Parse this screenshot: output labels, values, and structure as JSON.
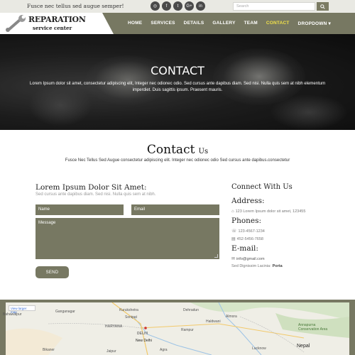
{
  "topbar": {
    "tagline": "Fusce nec tellus sed augue semper!",
    "social_icons": [
      "rss-icon",
      "facebook-icon",
      "twitter-icon",
      "google-plus-icon",
      "linkedin-icon"
    ],
    "social_glyphs": [
      "◎",
      "f",
      "t",
      "G+",
      "in"
    ],
    "search_placeholder": "Search"
  },
  "logo": {
    "line1": "REPARATION",
    "line2": "service center"
  },
  "nav": {
    "items": [
      "HOME",
      "SERVICES",
      "DETAILS",
      "GALLERY",
      "TEAM",
      "CONTACT",
      "DROPDOWN ▾"
    ],
    "active": "CONTACT"
  },
  "hero": {
    "title": "CONTACT",
    "text": "Lorem Ipsum dolor sit amet, consectetur adipiscing elit, Integer nec odionec odio. Sed cursus ante dapibus diam. Sed nisi. Nulla quis sem at nibh elementum imperdiet. Duis sagittis ipsum. Praesent mauris."
  },
  "contact_heading": {
    "title_big": "Contact",
    "title_small": "Us",
    "subtitle": "Fusce Nec Tellus Sed Augue consectetur adipiscing elit. Integer nec odionec odio Sed cursus ante dapibus.consectetur"
  },
  "form": {
    "title": "Lorem Ipsum Dolor Sit Amet:",
    "subtitle": "Sed cursus ante dapibus diam. Sed nisi. Nulla quis sem at nibh.",
    "name_placeholder": "Name",
    "email_placeholder": "Email",
    "message_placeholder": "Message",
    "send_label": "SEND"
  },
  "connect": {
    "title": "Connect With Us",
    "address_label": "Address:",
    "address": "123 Lorem Ipsum dolor sit amet, 123455",
    "phones_label": "Phones:",
    "phone1": "123-4567-1234",
    "phone2": "452-5456-7658",
    "email_label": "E-mail:",
    "email": "info@gmail.com",
    "note_prefix": "Sed Dignissim Lacinia:",
    "note_value": "Porta"
  },
  "map": {
    "view_larger": "View larger map",
    "labels": [
      "HARYANA",
      "DELHI",
      "New Delhi",
      "Rampur",
      "Lucknow",
      "Nepal",
      "Haldwani",
      "Bikaner",
      "Jaipur",
      "Agra",
      "Dehradun",
      "Annapurna Conservation Area",
      "Bahawalpur",
      "Ganganagar",
      "Kurukshetra",
      "Sonipat",
      "Almora"
    ]
  },
  "colors": {
    "accent": "#777862",
    "active_nav": "#f0e14a",
    "topbar_bg": "#e9e9e3"
  }
}
